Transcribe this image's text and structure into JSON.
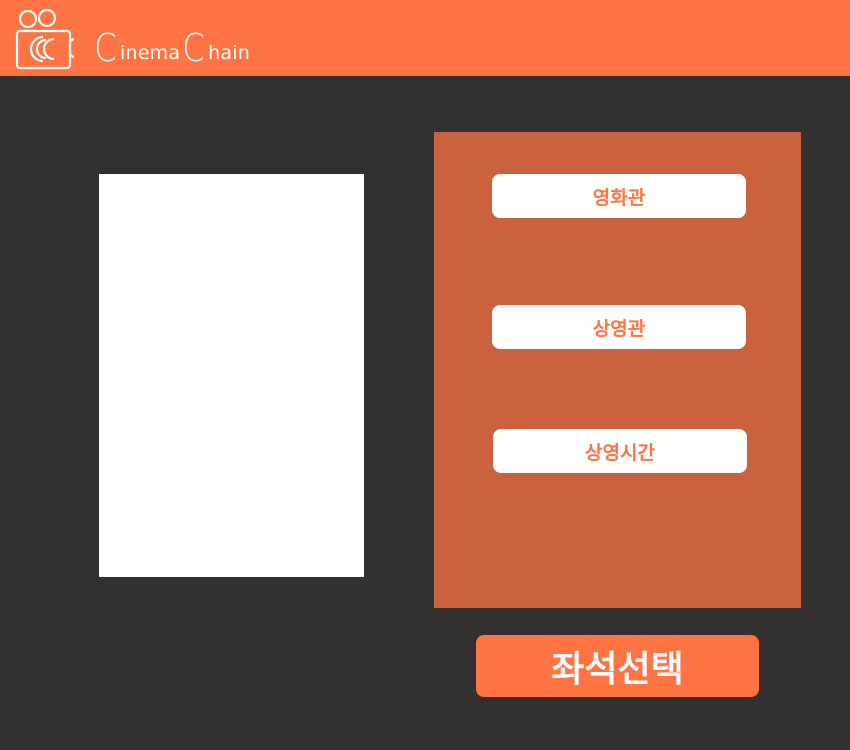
{
  "header": {
    "brand_first_initial": "C",
    "brand_first_rest": "inema",
    "brand_second_initial": "C",
    "brand_second_rest": "hain",
    "logo_icon": "movie-camera-icon"
  },
  "selection_panel": {
    "cinema_label": "영화관",
    "screen_label": "상영관",
    "showtime_label": "상영시간"
  },
  "seat_select_label": "좌석선택",
  "colors": {
    "accent": "#FF7442",
    "panel": "#CC623D",
    "background": "#323130",
    "card": "#FFFFFF"
  }
}
